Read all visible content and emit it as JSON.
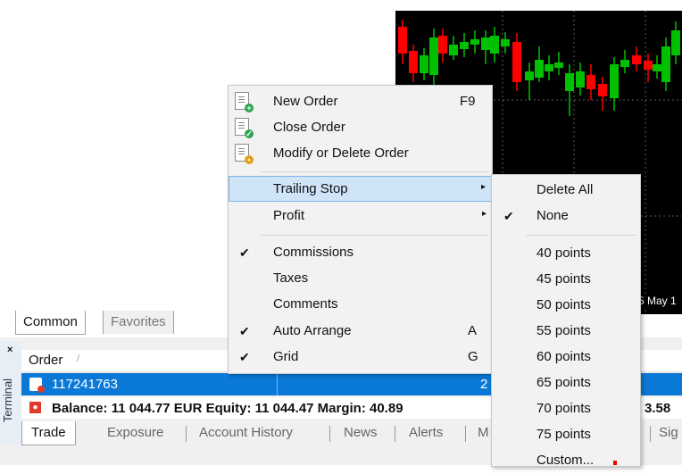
{
  "chart": {
    "date_label": "5 May 1",
    "colors": {
      "background": "#000000",
      "bull": "#00c000",
      "bear": "#ff0000",
      "grid": "#5a5a5a"
    }
  },
  "navigator_tabs": [
    "Common",
    "Favorites"
  ],
  "terminal": {
    "side_label": "Terminal",
    "close_symbol": "×",
    "header": {
      "order_label": "Order",
      "sort_indicator": "/"
    },
    "order_row": {
      "id": "117241763",
      "value": "2"
    },
    "balance_text": "Balance: 11 044.77 EUR  Equity: 11 044.47  Margin: 40.89",
    "balance_tail": "3.58",
    "tabs": [
      "Trade",
      "Exposure",
      "Account History",
      "News",
      "Alerts",
      "M",
      "Sig"
    ]
  },
  "context_menu": {
    "new_order": {
      "label": "New Order",
      "accel": "F9",
      "icon": "new-order-icon"
    },
    "close_order": {
      "label": "Close Order",
      "icon": "close-order-icon"
    },
    "modify_order": {
      "label": "Modify or Delete Order",
      "icon": "modify-order-icon"
    },
    "trailing_stop": {
      "label": "Trailing Stop",
      "arrow": "▸"
    },
    "profit": {
      "label": "Profit",
      "arrow": "▸"
    },
    "commissions": {
      "label": "Commissions",
      "check": "✔"
    },
    "taxes": {
      "label": "Taxes"
    },
    "comments": {
      "label": "Comments"
    },
    "auto_arrange": {
      "label": "Auto Arrange",
      "accel": "A",
      "check": "✔"
    },
    "grid": {
      "label": "Grid",
      "accel": "G",
      "check": "✔"
    }
  },
  "submenu": {
    "delete_all": "Delete All",
    "none": {
      "label": "None",
      "check": "✔"
    },
    "points": [
      "40 points",
      "45 points",
      "50 points",
      "55 points",
      "60 points",
      "65 points",
      "70 points",
      "75 points"
    ],
    "custom": "Custom..."
  }
}
